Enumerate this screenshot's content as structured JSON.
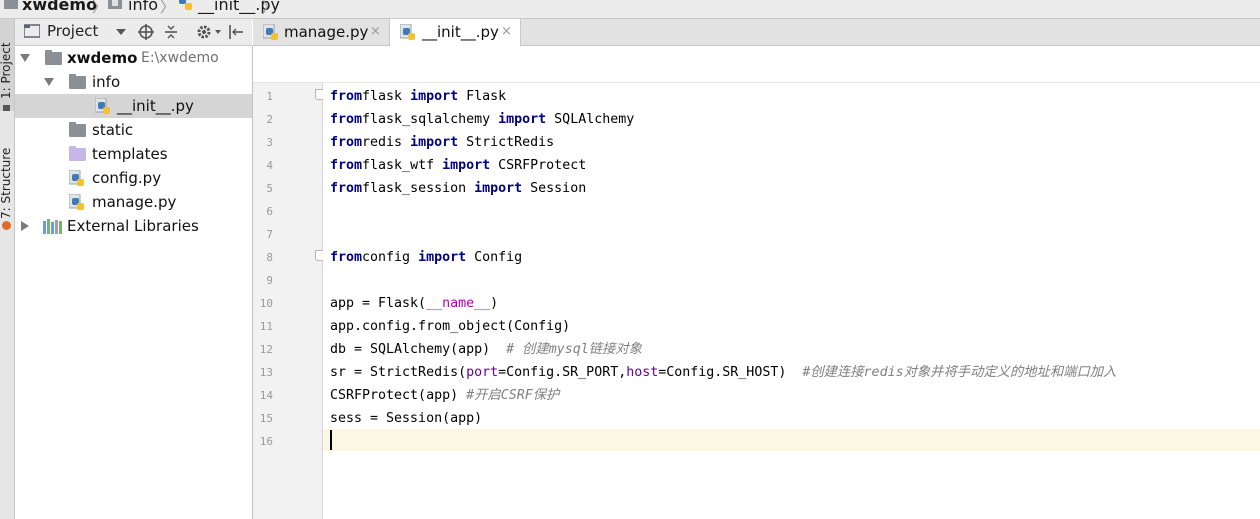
{
  "breadcrumb": [
    "xwdemo",
    "info",
    "__init__.py"
  ],
  "tool_stripe": {
    "project": "1: Project",
    "structure": "7: Structure"
  },
  "project_panel": {
    "title": "Project",
    "tree": [
      {
        "label": "xwdemo",
        "hint": "E:\\xwdemo",
        "icon": "folder-icon",
        "depth": 0,
        "expander": "expanded"
      },
      {
        "label": "info",
        "icon": "package-folder-icon",
        "depth": 1,
        "expander": "expanded"
      },
      {
        "label": "__init__.py",
        "icon": "python-file-icon",
        "depth": 2,
        "selected": true
      },
      {
        "label": "static",
        "icon": "folder-icon",
        "depth": 1
      },
      {
        "label": "templates",
        "icon": "templates-folder-icon",
        "depth": 1
      },
      {
        "label": "config.py",
        "icon": "python-file-icon",
        "depth": 1
      },
      {
        "label": "manage.py",
        "icon": "python-file-icon",
        "depth": 1
      },
      {
        "label": "External Libraries",
        "icon": "libraries-icon",
        "depth": 0,
        "expander": "collapsed"
      }
    ]
  },
  "tabs": [
    {
      "label": "manage.py",
      "active": false,
      "close": "×"
    },
    {
      "label": "__init__.py",
      "active": true,
      "close": "×"
    }
  ],
  "editor": {
    "line_numbers": [
      "1",
      "2",
      "3",
      "4",
      "5",
      "6",
      "7",
      "8",
      "9",
      "10",
      "11",
      "12",
      "13",
      "14",
      "15",
      "16"
    ],
    "caret_line": 16,
    "lines": [
      [
        [
          "kw",
          "from"
        ],
        [
          "",
          "flask "
        ],
        [
          "kw",
          "import"
        ],
        [
          "",
          " Flask"
        ]
      ],
      [
        [
          "kw",
          "from"
        ],
        [
          "",
          "flask_sqlalchemy "
        ],
        [
          "kw",
          "import"
        ],
        [
          "",
          " SQLAlchemy"
        ]
      ],
      [
        [
          "kw",
          "from"
        ],
        [
          "",
          "redis "
        ],
        [
          "kw",
          "import"
        ],
        [
          "",
          " StrictRedis"
        ]
      ],
      [
        [
          "kw",
          "from"
        ],
        [
          "",
          "flask_wtf "
        ],
        [
          "kw",
          "import"
        ],
        [
          "",
          " CSRFProtect"
        ]
      ],
      [
        [
          "kw",
          "from"
        ],
        [
          "",
          "flask_session "
        ],
        [
          "kw",
          "import"
        ],
        [
          "",
          " Session"
        ]
      ],
      [],
      [],
      [
        [
          "kw",
          "from"
        ],
        [
          "",
          "config "
        ],
        [
          "kw",
          "import"
        ],
        [
          "",
          " Config"
        ]
      ],
      [],
      [
        [
          "",
          "app = Flask("
        ],
        [
          "magic",
          "__name__"
        ],
        [
          "",
          ")"
        ]
      ],
      [
        [
          "",
          "app.config.from_object(Config)"
        ]
      ],
      [
        [
          "",
          "db = SQLAlchemy(app)  "
        ],
        [
          "cm",
          "# 创建mysql链接对象"
        ]
      ],
      [
        [
          "",
          "sr = StrictRedis("
        ],
        [
          "pm",
          "port"
        ],
        [
          "",
          "=Config.SR_PORT,"
        ],
        [
          "pm",
          "host"
        ],
        [
          "",
          "=Config.SR_HOST)  "
        ],
        [
          "cm",
          "#创建连接redis对象并将手动定义的地址和端口加入"
        ]
      ],
      [
        [
          "",
          "CSRFProtect(app) "
        ],
        [
          "cm",
          "#开启CSRF保护"
        ]
      ],
      [
        [
          "",
          "sess = Session(app)"
        ]
      ],
      []
    ]
  },
  "colors": {
    "keyword": "#000080",
    "comment": "#808080",
    "param": "#660099",
    "magic": "#b200b2",
    "caret_line": "#fcf7e2",
    "selection": "#d5d5d5"
  }
}
